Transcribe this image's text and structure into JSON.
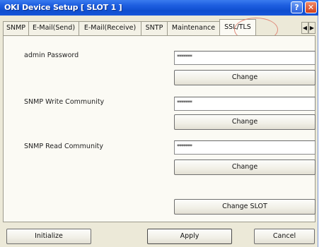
{
  "window": {
    "title": "OKI Device Setup [ SLOT 1 ]",
    "help_label": "?",
    "close_label": "✕"
  },
  "tabs": [
    {
      "label": "SNMP",
      "active": false
    },
    {
      "label": "E-Mail(Send)",
      "active": false
    },
    {
      "label": "E-Mail(Receive)",
      "active": false
    },
    {
      "label": "SNTP",
      "active": false
    },
    {
      "label": "Maintenance",
      "active": false
    },
    {
      "label": "SSL/TLS",
      "active": true
    }
  ],
  "tab_scroll": {
    "left": "◀",
    "right": "▶"
  },
  "fields": [
    {
      "label": "admin Password",
      "value": "*******",
      "button": "Change"
    },
    {
      "label": "SNMP Write Community",
      "value": "*******",
      "button": "Change"
    },
    {
      "label": "SNMP Read Community",
      "value": "*******",
      "button": "Change"
    }
  ],
  "change_slot_label": "Change SLOT",
  "footer": {
    "initialize_label": "Initialize",
    "apply_label": "Apply",
    "cancel_label": "Cancel"
  },
  "colors": {
    "title_bar": "#1d5ee0",
    "dialog_bg": "#ece9d8",
    "highlight_ring": "#e08a7a"
  }
}
